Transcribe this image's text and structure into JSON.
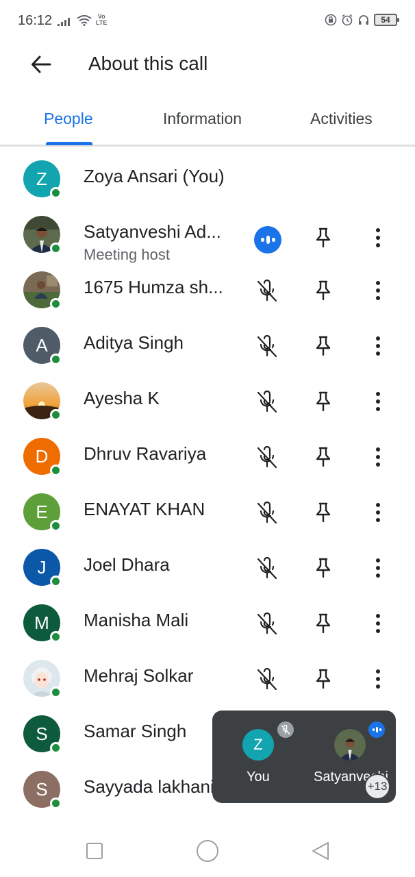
{
  "status_bar": {
    "time": "16:12",
    "volte_top": "Vo",
    "volte_bottom": "LTE",
    "battery": "54"
  },
  "app_bar": {
    "back_icon": "arrow-back-icon",
    "title": "About this call"
  },
  "tabs": [
    {
      "label": "People",
      "active": true
    },
    {
      "label": "Information",
      "active": false
    },
    {
      "label": "Activities",
      "active": false
    }
  ],
  "people": [
    {
      "name": "Zoya Ansari (You)",
      "initial": "Z",
      "avatar_color": "#12a4af"
    },
    {
      "name": "Satyanveshi Ad...",
      "subtitle": "Meeting host",
      "photo": true,
      "speaking": true
    },
    {
      "name": "1675 Humza sh...",
      "photo": true,
      "muted": true
    },
    {
      "name": "Aditya Singh",
      "initial": "A",
      "avatar_color": "#4f5b66",
      "muted": true
    },
    {
      "name": "Ayesha K",
      "photo": true,
      "muted": true
    },
    {
      "name": "Dhruv Ravariya",
      "initial": "D",
      "avatar_color": "#ef6c00",
      "muted": true
    },
    {
      "name": "ENAYAT KHAN",
      "initial": "E",
      "avatar_color": "#5e9f3a",
      "muted": true
    },
    {
      "name": "Joel Dhara",
      "initial": "J",
      "avatar_color": "#0b57a8",
      "muted": true
    },
    {
      "name": "Manisha Mali",
      "initial": "M",
      "avatar_color": "#0e5a3c",
      "muted": true
    },
    {
      "name": "Mehraj Solkar",
      "photo": true,
      "muted": true
    },
    {
      "name": "Samar Singh",
      "initial": "S",
      "avatar_color": "#0e5a3c"
    },
    {
      "name": "Sayyada lakhani",
      "initial": "S",
      "avatar_color": "#8d6e63"
    }
  ],
  "mini_call": {
    "you_initial": "Z",
    "you_label": "You",
    "other_label": "Satyanveshi",
    "more_count": "+13"
  },
  "colors": {
    "accent": "#1a73e8",
    "online": "#1e8e3e",
    "pip_background": "#3c4043"
  }
}
